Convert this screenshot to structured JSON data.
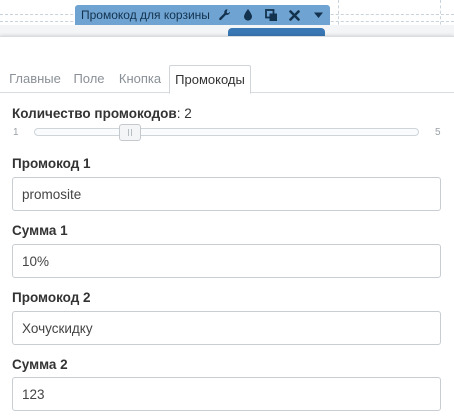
{
  "widget": {
    "title": "Промокод для корзины",
    "icons": [
      "wrench-icon",
      "drop-icon",
      "copy-icon",
      "close-icon",
      "caret-down-icon"
    ],
    "bar_color": "#6fa3d1"
  },
  "tabs": [
    {
      "label": "Главные",
      "active": false
    },
    {
      "label": "Поле",
      "active": false
    },
    {
      "label": "Кнопка",
      "active": false
    },
    {
      "label": "Промокоды",
      "active": true
    }
  ],
  "promo_count": {
    "label": "Количество промокодов",
    "separator": ":",
    "value": "2",
    "min": "1",
    "max": "5",
    "current": 2
  },
  "fields": [
    {
      "label": "Промокод 1",
      "value": "promosite"
    },
    {
      "label": "Сумма 1",
      "value": "10%"
    },
    {
      "label": "Промокод 2",
      "value": "Хочускидку"
    },
    {
      "label": "Сумма 2",
      "value": "123"
    }
  ]
}
